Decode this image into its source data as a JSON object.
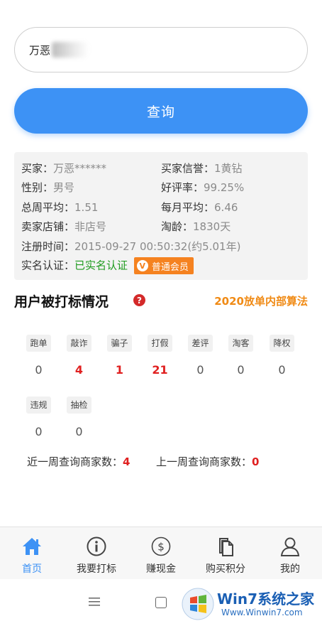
{
  "search": {
    "value": "万恶"
  },
  "query_button": {
    "label": "查询"
  },
  "info": {
    "buyer_label": "买家：",
    "buyer_value": "万恶******",
    "reputation_label": "买家信誉：",
    "reputation_value": "1黄钻",
    "gender_label": "性别：",
    "gender_value": "男号",
    "positive_rate_label": "好评率：",
    "positive_rate_value": "99.25%",
    "weekly_avg_label": "总周平均：",
    "weekly_avg_value": "1.51",
    "monthly_avg_label": "每月平均：",
    "monthly_avg_value": "6.46",
    "seller_shop_label": "卖家店铺：",
    "seller_shop_value": "非店号",
    "taobao_age_label": "淘龄：",
    "taobao_age_value": "1830天",
    "reg_time_label": "注册时间：",
    "reg_time_value": "2015-09-27 00:50:32(约5.01年)",
    "realname_label": "实名认证：",
    "realname_value": "已实名认证",
    "member_badge": "普通会员",
    "member_badge_icon": "V"
  },
  "section": {
    "title": "用户被打标情况",
    "help_icon": "?",
    "algo_link": "2020放单内部算法"
  },
  "tags": [
    {
      "label": "跑单",
      "count": "0",
      "hot": false
    },
    {
      "label": "敲诈",
      "count": "4",
      "hot": true
    },
    {
      "label": "骗子",
      "count": "1",
      "hot": true
    },
    {
      "label": "打假",
      "count": "21",
      "hot": true
    },
    {
      "label": "差评",
      "count": "0",
      "hot": false
    },
    {
      "label": "淘客",
      "count": "0",
      "hot": false
    },
    {
      "label": "降权",
      "count": "0",
      "hot": false
    },
    {
      "label": "违规",
      "count": "0",
      "hot": false
    },
    {
      "label": "抽检",
      "count": "0",
      "hot": false
    }
  ],
  "weekly": {
    "last_week_label": "近一周查询商家数：",
    "last_week_value": "4",
    "prev_week_label": "上一周查询商家数：",
    "prev_week_value": "0"
  },
  "nav": [
    {
      "label": "首页",
      "icon": "home-icon",
      "active": true
    },
    {
      "label": "我要打标",
      "icon": "info-icon",
      "active": false
    },
    {
      "label": "赚现金",
      "icon": "dollar-icon",
      "active": false
    },
    {
      "label": "购买积分",
      "icon": "documents-icon",
      "active": false
    },
    {
      "label": "我的",
      "icon": "user-icon",
      "active": false
    }
  ],
  "watermark": {
    "title": "Win7系统之家",
    "url": "Www.Winwin7.com"
  },
  "colors": {
    "accent": "#3d92f5",
    "warning": "#f08a14",
    "danger": "#e02020",
    "success": "#1e9b1e"
  }
}
